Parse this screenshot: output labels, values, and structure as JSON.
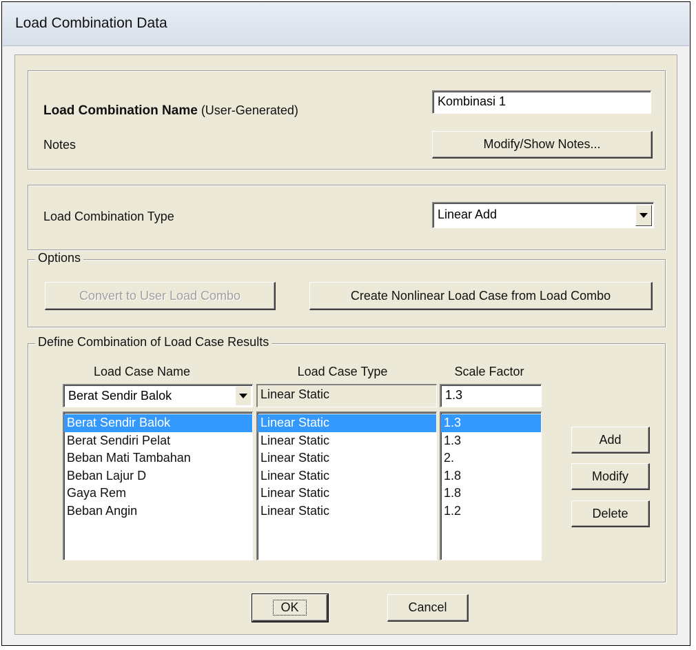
{
  "window": {
    "title": "Load Combination Data"
  },
  "name_section": {
    "label_bold": "Load Combination Name",
    "label_suffix": "(User-Generated)",
    "name_value": "Kombinasi 1",
    "notes_label": "Notes",
    "notes_button": "Modify/Show Notes..."
  },
  "type_section": {
    "label": "Load Combination Type",
    "selected": "Linear Add"
  },
  "options": {
    "legend": "Options",
    "convert_button": "Convert to User Load Combo",
    "create_button": "Create Nonlinear Load Case from Load Combo"
  },
  "define": {
    "legend": "Define Combination of Load Case Results",
    "headers": {
      "name": "Load Case Name",
      "type": "Load Case Type",
      "scale": "Scale Factor"
    },
    "current": {
      "name": "Berat Sendir Balok",
      "type": "Linear Static",
      "scale": "1.3"
    },
    "rows": [
      {
        "name": "Berat Sendir Balok",
        "type": "Linear Static",
        "scale": "1.3",
        "selected": true
      },
      {
        "name": "Berat Sendiri Pelat",
        "type": "Linear Static",
        "scale": "1.3"
      },
      {
        "name": "Beban Mati Tambahan",
        "type": "Linear Static",
        "scale": "2."
      },
      {
        "name": "Beban Lajur D",
        "type": "Linear Static",
        "scale": "1.8"
      },
      {
        "name": "Gaya Rem",
        "type": "Linear Static",
        "scale": "1.8"
      },
      {
        "name": "Beban Angin",
        "type": "Linear Static",
        "scale": "1.2"
      }
    ],
    "add_button": "Add",
    "modify_button": "Modify",
    "delete_button": "Delete"
  },
  "footer": {
    "ok_button": "OK",
    "cancel_button": "Cancel"
  },
  "colors": {
    "selection": "#3399ff",
    "dialog_bg": "#ece9d8"
  }
}
